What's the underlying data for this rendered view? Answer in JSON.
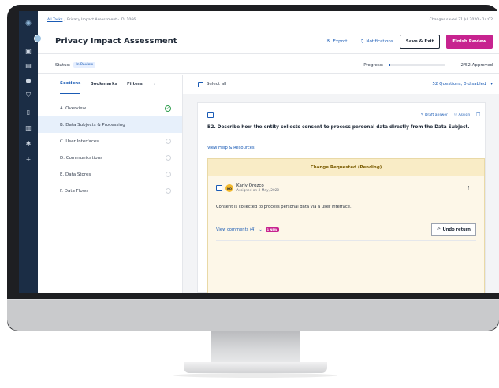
{
  "breadcrumb": {
    "root": "All Tasks",
    "current": "Privacy Impact Assessment - ID: 1066"
  },
  "save_status": "Changes saved 31 Jul 2020 - 14:02",
  "header": {
    "title": "Privacy Impact Assessment",
    "export_label": "Export",
    "notifications_label": "Notifications",
    "save_exit_label": "Save & Exit",
    "finish_label": "Finish Review"
  },
  "status": {
    "label": "Status:",
    "value": "In Review",
    "progress_label": "Progress:",
    "progress_fraction": 0.04,
    "approved_text": "2/52 Approved"
  },
  "tabs": [
    {
      "label": "Sections"
    },
    {
      "label": "Bookmarks"
    },
    {
      "label": "Filters"
    }
  ],
  "sections": [
    {
      "label": "A. Overview",
      "state": "complete"
    },
    {
      "label": "B. Data Subjects & Processing",
      "state": "selected"
    },
    {
      "label": "C. User Interfaces",
      "state": "empty"
    },
    {
      "label": "D. Communications",
      "state": "empty"
    },
    {
      "label": "E. Data Stores",
      "state": "empty"
    },
    {
      "label": "F. Data Flows",
      "state": "empty"
    }
  ],
  "toolbar": {
    "select_all_label": "Select all",
    "questions_summary": "52 Questions, 0 disabled"
  },
  "question": {
    "draft_label": "Draft answer",
    "assign_label": "Assign",
    "text": "B2. Describe how the entity collects consent to process personal data directly from the Data Subject.",
    "help_link": "View Help & Resources"
  },
  "change_request": {
    "title": "Change Requested (Pending)",
    "author": "Karly Orozco",
    "initials": "KO",
    "date": "Assigned on 3 May, 2020",
    "comment": "Consent is collected to process personal data via a user interface.",
    "view_comments": "View comments (4)",
    "new_badge": "1 NEW",
    "undo_label": "Undo return"
  },
  "icons": {
    "rail": [
      "app-logo-icon",
      "home-icon",
      "building-icon",
      "globe-icon",
      "shield-icon",
      "document-icon",
      "library-icon",
      "settings-icon",
      "plus-icon"
    ]
  },
  "colors": {
    "accent": "#1a5bb5",
    "brand": "#c7238f",
    "rail": "#1b2d45",
    "success": "#2e9d4d",
    "warning_bg": "#fdf7e8"
  }
}
